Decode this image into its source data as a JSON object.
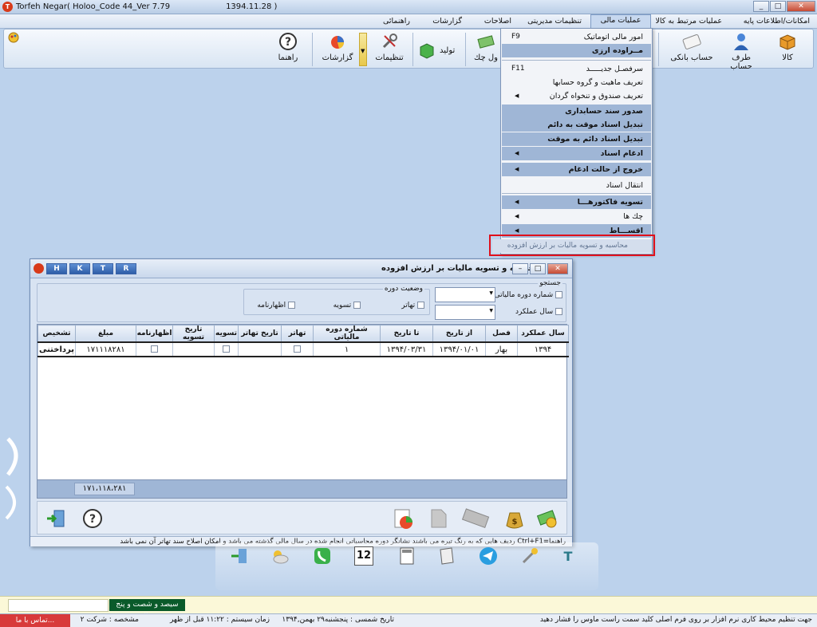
{
  "window": {
    "title": "Torfeh Negar( Holoo_Code 44_Ver 7.79",
    "date": "1394.11.28 )",
    "min": "_",
    "max": "□",
    "close": "✕"
  },
  "menubar": [
    {
      "label": "امکانات/اطلاعات پایه"
    },
    {
      "label": "عملیات مرتبط به کالا"
    },
    {
      "label": "عملیات مالی"
    },
    {
      "label": "تنظیمات مدیریتی"
    },
    {
      "label": "اصلاحات"
    },
    {
      "label": "گزارشات"
    },
    {
      "label": "راهنمائی"
    }
  ],
  "toolbar": {
    "kala": "کالا",
    "taraf_hesab": "طرف حساب",
    "hesab_banki": "حساب بانکی",
    "chek": "ول چك",
    "tolid": "تولید",
    "tanzimat": "تنظیمات",
    "gozareshat": "گزارشات",
    "rahnama": "راهنما"
  },
  "dropdown": [
    {
      "label": "امور مالی اتوماتیک",
      "shortcut": "F9",
      "style": "normal"
    },
    {
      "label": "مــراوده ارزی",
      "shortcut": "",
      "style": "dark"
    },
    {
      "label": "سرفصـل جدیـــــد",
      "shortcut": "F11",
      "style": "normal"
    },
    {
      "label": "تعریف ماهیت و گروه حسابها",
      "shortcut": "",
      "style": "normal"
    },
    {
      "label": "تعریف صندوق و تنخواه گردان",
      "shortcut": "",
      "style": "normal",
      "sub": true
    },
    {
      "label": "صدور سند حسابداری",
      "shortcut": "",
      "style": "dark"
    },
    {
      "label": "تبدیل اسناد موقت به دائم",
      "shortcut": "",
      "style": "dark"
    },
    {
      "label": "تبدیل اسناد دائم به موقت",
      "shortcut": "",
      "style": "dark"
    },
    {
      "label": "ادغام اسناد",
      "shortcut": "",
      "style": "dark",
      "sub": true
    },
    {
      "label": "خروج از حالت ادغام",
      "shortcut": "",
      "style": "dark",
      "sub": true
    },
    {
      "label": "انتقال اسناد",
      "shortcut": "",
      "style": "normal"
    },
    {
      "label": "تسویه فاکتورهـــا",
      "shortcut": "",
      "style": "dark",
      "sub": true
    },
    {
      "label": "چك ها",
      "shortcut": "",
      "style": "normal",
      "sub": true
    },
    {
      "label": "اقســـاط",
      "shortcut": "",
      "style": "dark",
      "sub": true
    }
  ],
  "vat_item": "محاسبه و تسویه مالیات بر ارزش افزوده",
  "dialog": {
    "title": "محاسبه و تسویه مالیات بر ارزش افزوده",
    "hotkeys": [
      "H",
      "K",
      "T",
      "R"
    ],
    "search_title": "جستجو",
    "search_period": "شماره دوره مالیاتی",
    "search_year": "سال عملکرد",
    "status_title": "وضعیت دوره",
    "status_tahator": "تهاتر",
    "status_tasvieh": "تسویه",
    "status_ezharname": "اظهارنامه",
    "columns": [
      "سال عملکرد",
      "فصل",
      "از تاریخ",
      "تا تاریخ",
      "شماره دوره مالیاتی",
      "تهاتر",
      "تاریخ تهاتر",
      "تسویه",
      "تاریخ تسویه",
      "اظهارنامه",
      "مبلغ",
      "تشخیص"
    ],
    "rows": [
      [
        "۱۳۹۴",
        "بهار",
        "۱۳۹۴/۰۱/۰۱",
        "۱۳۹۴/۰۳/۳۱",
        "۱",
        "",
        "",
        "",
        "",
        "",
        "۱۷۱۱۱۸۲۸۱",
        "پرداختنی"
      ]
    ],
    "total": "۱۷۱،۱۱۸،۲۸۱",
    "status": "راهنما=Ctrl+F1     ردیف هایی که به رنگ تیره می باشند نشانگر دوره محاسباتی انجام شده در سال مالی گذشته می باشد و امکان اصلاح سند تهاتر آن نمی باشد"
  },
  "dock": {
    "calendar_day": "12"
  },
  "msgbar": {
    "amount_words": "سیصد و شصت و پنج ریال"
  },
  "statusbar": {
    "hint": "جهت تنظیم محیط کاری نرم افزار بر روی فرم اصلی کلید سمت راست ماوس را فشار دهید",
    "date": "تاریخ شمسی : پنجشنبه۲۹ بهمن,۱۳۹۴",
    "time": "زمان سیستم : ۱۱:۲۲ قبل از ظهر",
    "company": "مشخصه : شرکت ۲",
    "contact": "تماس با ما..."
  },
  "colors": {
    "accent": "#9fb6d6",
    "highlight_box": "#e0101b",
    "contact_bg": "#d83a3a"
  }
}
